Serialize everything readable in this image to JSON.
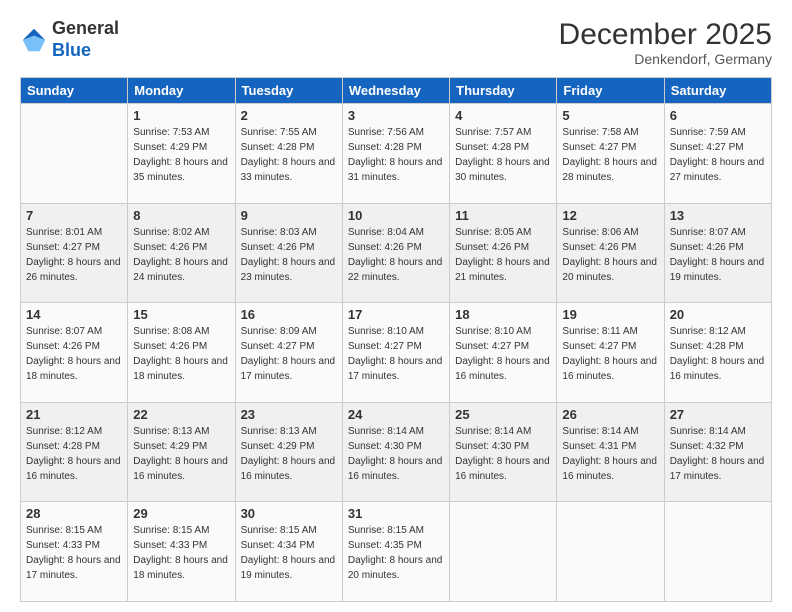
{
  "logo": {
    "general": "General",
    "blue": "Blue"
  },
  "title": "December 2025",
  "location": "Denkendorf, Germany",
  "days_of_week": [
    "Sunday",
    "Monday",
    "Tuesday",
    "Wednesday",
    "Thursday",
    "Friday",
    "Saturday"
  ],
  "weeks": [
    [
      {
        "day": "",
        "sunrise": "",
        "sunset": "",
        "daylight": ""
      },
      {
        "day": "1",
        "sunrise": "Sunrise: 7:53 AM",
        "sunset": "Sunset: 4:29 PM",
        "daylight": "Daylight: 8 hours and 35 minutes."
      },
      {
        "day": "2",
        "sunrise": "Sunrise: 7:55 AM",
        "sunset": "Sunset: 4:28 PM",
        "daylight": "Daylight: 8 hours and 33 minutes."
      },
      {
        "day": "3",
        "sunrise": "Sunrise: 7:56 AM",
        "sunset": "Sunset: 4:28 PM",
        "daylight": "Daylight: 8 hours and 31 minutes."
      },
      {
        "day": "4",
        "sunrise": "Sunrise: 7:57 AM",
        "sunset": "Sunset: 4:28 PM",
        "daylight": "Daylight: 8 hours and 30 minutes."
      },
      {
        "day": "5",
        "sunrise": "Sunrise: 7:58 AM",
        "sunset": "Sunset: 4:27 PM",
        "daylight": "Daylight: 8 hours and 28 minutes."
      },
      {
        "day": "6",
        "sunrise": "Sunrise: 7:59 AM",
        "sunset": "Sunset: 4:27 PM",
        "daylight": "Daylight: 8 hours and 27 minutes."
      }
    ],
    [
      {
        "day": "7",
        "sunrise": "Sunrise: 8:01 AM",
        "sunset": "Sunset: 4:27 PM",
        "daylight": "Daylight: 8 hours and 26 minutes."
      },
      {
        "day": "8",
        "sunrise": "Sunrise: 8:02 AM",
        "sunset": "Sunset: 4:26 PM",
        "daylight": "Daylight: 8 hours and 24 minutes."
      },
      {
        "day": "9",
        "sunrise": "Sunrise: 8:03 AM",
        "sunset": "Sunset: 4:26 PM",
        "daylight": "Daylight: 8 hours and 23 minutes."
      },
      {
        "day": "10",
        "sunrise": "Sunrise: 8:04 AM",
        "sunset": "Sunset: 4:26 PM",
        "daylight": "Daylight: 8 hours and 22 minutes."
      },
      {
        "day": "11",
        "sunrise": "Sunrise: 8:05 AM",
        "sunset": "Sunset: 4:26 PM",
        "daylight": "Daylight: 8 hours and 21 minutes."
      },
      {
        "day": "12",
        "sunrise": "Sunrise: 8:06 AM",
        "sunset": "Sunset: 4:26 PM",
        "daylight": "Daylight: 8 hours and 20 minutes."
      },
      {
        "day": "13",
        "sunrise": "Sunrise: 8:07 AM",
        "sunset": "Sunset: 4:26 PM",
        "daylight": "Daylight: 8 hours and 19 minutes."
      }
    ],
    [
      {
        "day": "14",
        "sunrise": "Sunrise: 8:07 AM",
        "sunset": "Sunset: 4:26 PM",
        "daylight": "Daylight: 8 hours and 18 minutes."
      },
      {
        "day": "15",
        "sunrise": "Sunrise: 8:08 AM",
        "sunset": "Sunset: 4:26 PM",
        "daylight": "Daylight: 8 hours and 18 minutes."
      },
      {
        "day": "16",
        "sunrise": "Sunrise: 8:09 AM",
        "sunset": "Sunset: 4:27 PM",
        "daylight": "Daylight: 8 hours and 17 minutes."
      },
      {
        "day": "17",
        "sunrise": "Sunrise: 8:10 AM",
        "sunset": "Sunset: 4:27 PM",
        "daylight": "Daylight: 8 hours and 17 minutes."
      },
      {
        "day": "18",
        "sunrise": "Sunrise: 8:10 AM",
        "sunset": "Sunset: 4:27 PM",
        "daylight": "Daylight: 8 hours and 16 minutes."
      },
      {
        "day": "19",
        "sunrise": "Sunrise: 8:11 AM",
        "sunset": "Sunset: 4:27 PM",
        "daylight": "Daylight: 8 hours and 16 minutes."
      },
      {
        "day": "20",
        "sunrise": "Sunrise: 8:12 AM",
        "sunset": "Sunset: 4:28 PM",
        "daylight": "Daylight: 8 hours and 16 minutes."
      }
    ],
    [
      {
        "day": "21",
        "sunrise": "Sunrise: 8:12 AM",
        "sunset": "Sunset: 4:28 PM",
        "daylight": "Daylight: 8 hours and 16 minutes."
      },
      {
        "day": "22",
        "sunrise": "Sunrise: 8:13 AM",
        "sunset": "Sunset: 4:29 PM",
        "daylight": "Daylight: 8 hours and 16 minutes."
      },
      {
        "day": "23",
        "sunrise": "Sunrise: 8:13 AM",
        "sunset": "Sunset: 4:29 PM",
        "daylight": "Daylight: 8 hours and 16 minutes."
      },
      {
        "day": "24",
        "sunrise": "Sunrise: 8:14 AM",
        "sunset": "Sunset: 4:30 PM",
        "daylight": "Daylight: 8 hours and 16 minutes."
      },
      {
        "day": "25",
        "sunrise": "Sunrise: 8:14 AM",
        "sunset": "Sunset: 4:30 PM",
        "daylight": "Daylight: 8 hours and 16 minutes."
      },
      {
        "day": "26",
        "sunrise": "Sunrise: 8:14 AM",
        "sunset": "Sunset: 4:31 PM",
        "daylight": "Daylight: 8 hours and 16 minutes."
      },
      {
        "day": "27",
        "sunrise": "Sunrise: 8:14 AM",
        "sunset": "Sunset: 4:32 PM",
        "daylight": "Daylight: 8 hours and 17 minutes."
      }
    ],
    [
      {
        "day": "28",
        "sunrise": "Sunrise: 8:15 AM",
        "sunset": "Sunset: 4:33 PM",
        "daylight": "Daylight: 8 hours and 17 minutes."
      },
      {
        "day": "29",
        "sunrise": "Sunrise: 8:15 AM",
        "sunset": "Sunset: 4:33 PM",
        "daylight": "Daylight: 8 hours and 18 minutes."
      },
      {
        "day": "30",
        "sunrise": "Sunrise: 8:15 AM",
        "sunset": "Sunset: 4:34 PM",
        "daylight": "Daylight: 8 hours and 19 minutes."
      },
      {
        "day": "31",
        "sunrise": "Sunrise: 8:15 AM",
        "sunset": "Sunset: 4:35 PM",
        "daylight": "Daylight: 8 hours and 20 minutes."
      },
      {
        "day": "",
        "sunrise": "",
        "sunset": "",
        "daylight": ""
      },
      {
        "day": "",
        "sunrise": "",
        "sunset": "",
        "daylight": ""
      },
      {
        "day": "",
        "sunrise": "",
        "sunset": "",
        "daylight": ""
      }
    ]
  ]
}
